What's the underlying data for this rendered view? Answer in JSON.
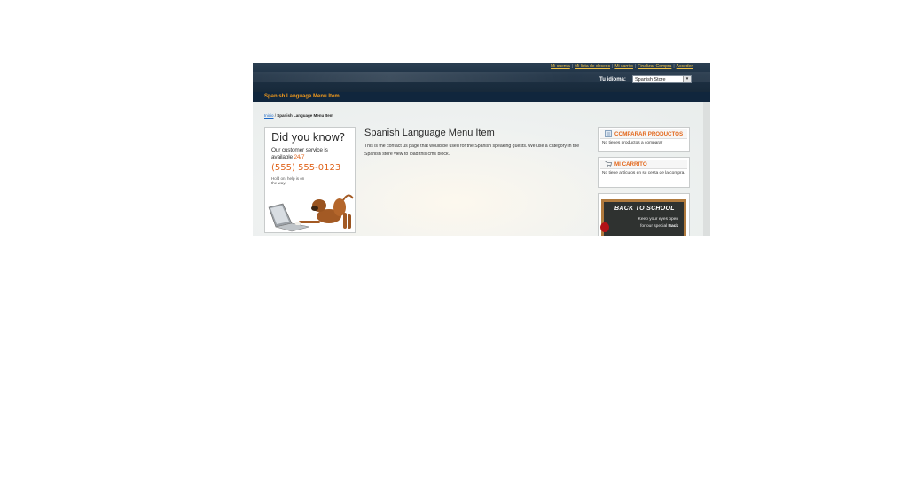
{
  "header": {
    "quick_links": [
      "Mi cuenta",
      "Mi lista de deseos",
      "Mi carrito",
      "Finalizar Compra",
      "Acceder"
    ],
    "language_label": "Tu idioma:",
    "language_selected": "Spanish Store"
  },
  "nav": {
    "item": "Spanish Language Menu Item"
  },
  "breadcrumb": {
    "home": "Inicio",
    "separator": " / ",
    "current": "Spanish Language Menu Item"
  },
  "callout": {
    "title": "Did you know?",
    "line1": "Our customer service is",
    "line2_prefix": "available ",
    "line2_highlight": "24/7",
    "phone": "(555) 555-0123",
    "small_text": "Hold on, help is on the way."
  },
  "main": {
    "title": "Spanish Language Menu Item",
    "text": "This is the contact us page that would be used for the Spanish speaking guests. We use a category in the Spanish store view to load this cms block."
  },
  "sidebar": {
    "compare": {
      "title": "COMPARAR PRODUCTOS",
      "body": "No tienes productos a comparar"
    },
    "cart": {
      "title": "MI CARRITO",
      "body": "No tiene artículos en su cesta de la compra."
    },
    "promo": {
      "title": "BACK TO SCHOOL",
      "line1": "Keep your eyes open",
      "line2_prefix": "for our special ",
      "line2_bold": "Back"
    }
  },
  "colors": {
    "accent_orange": "#e3671b",
    "header_dark": "#17293a",
    "link_yellow": "#f1c34a",
    "link_blue": "#1a66c7"
  }
}
